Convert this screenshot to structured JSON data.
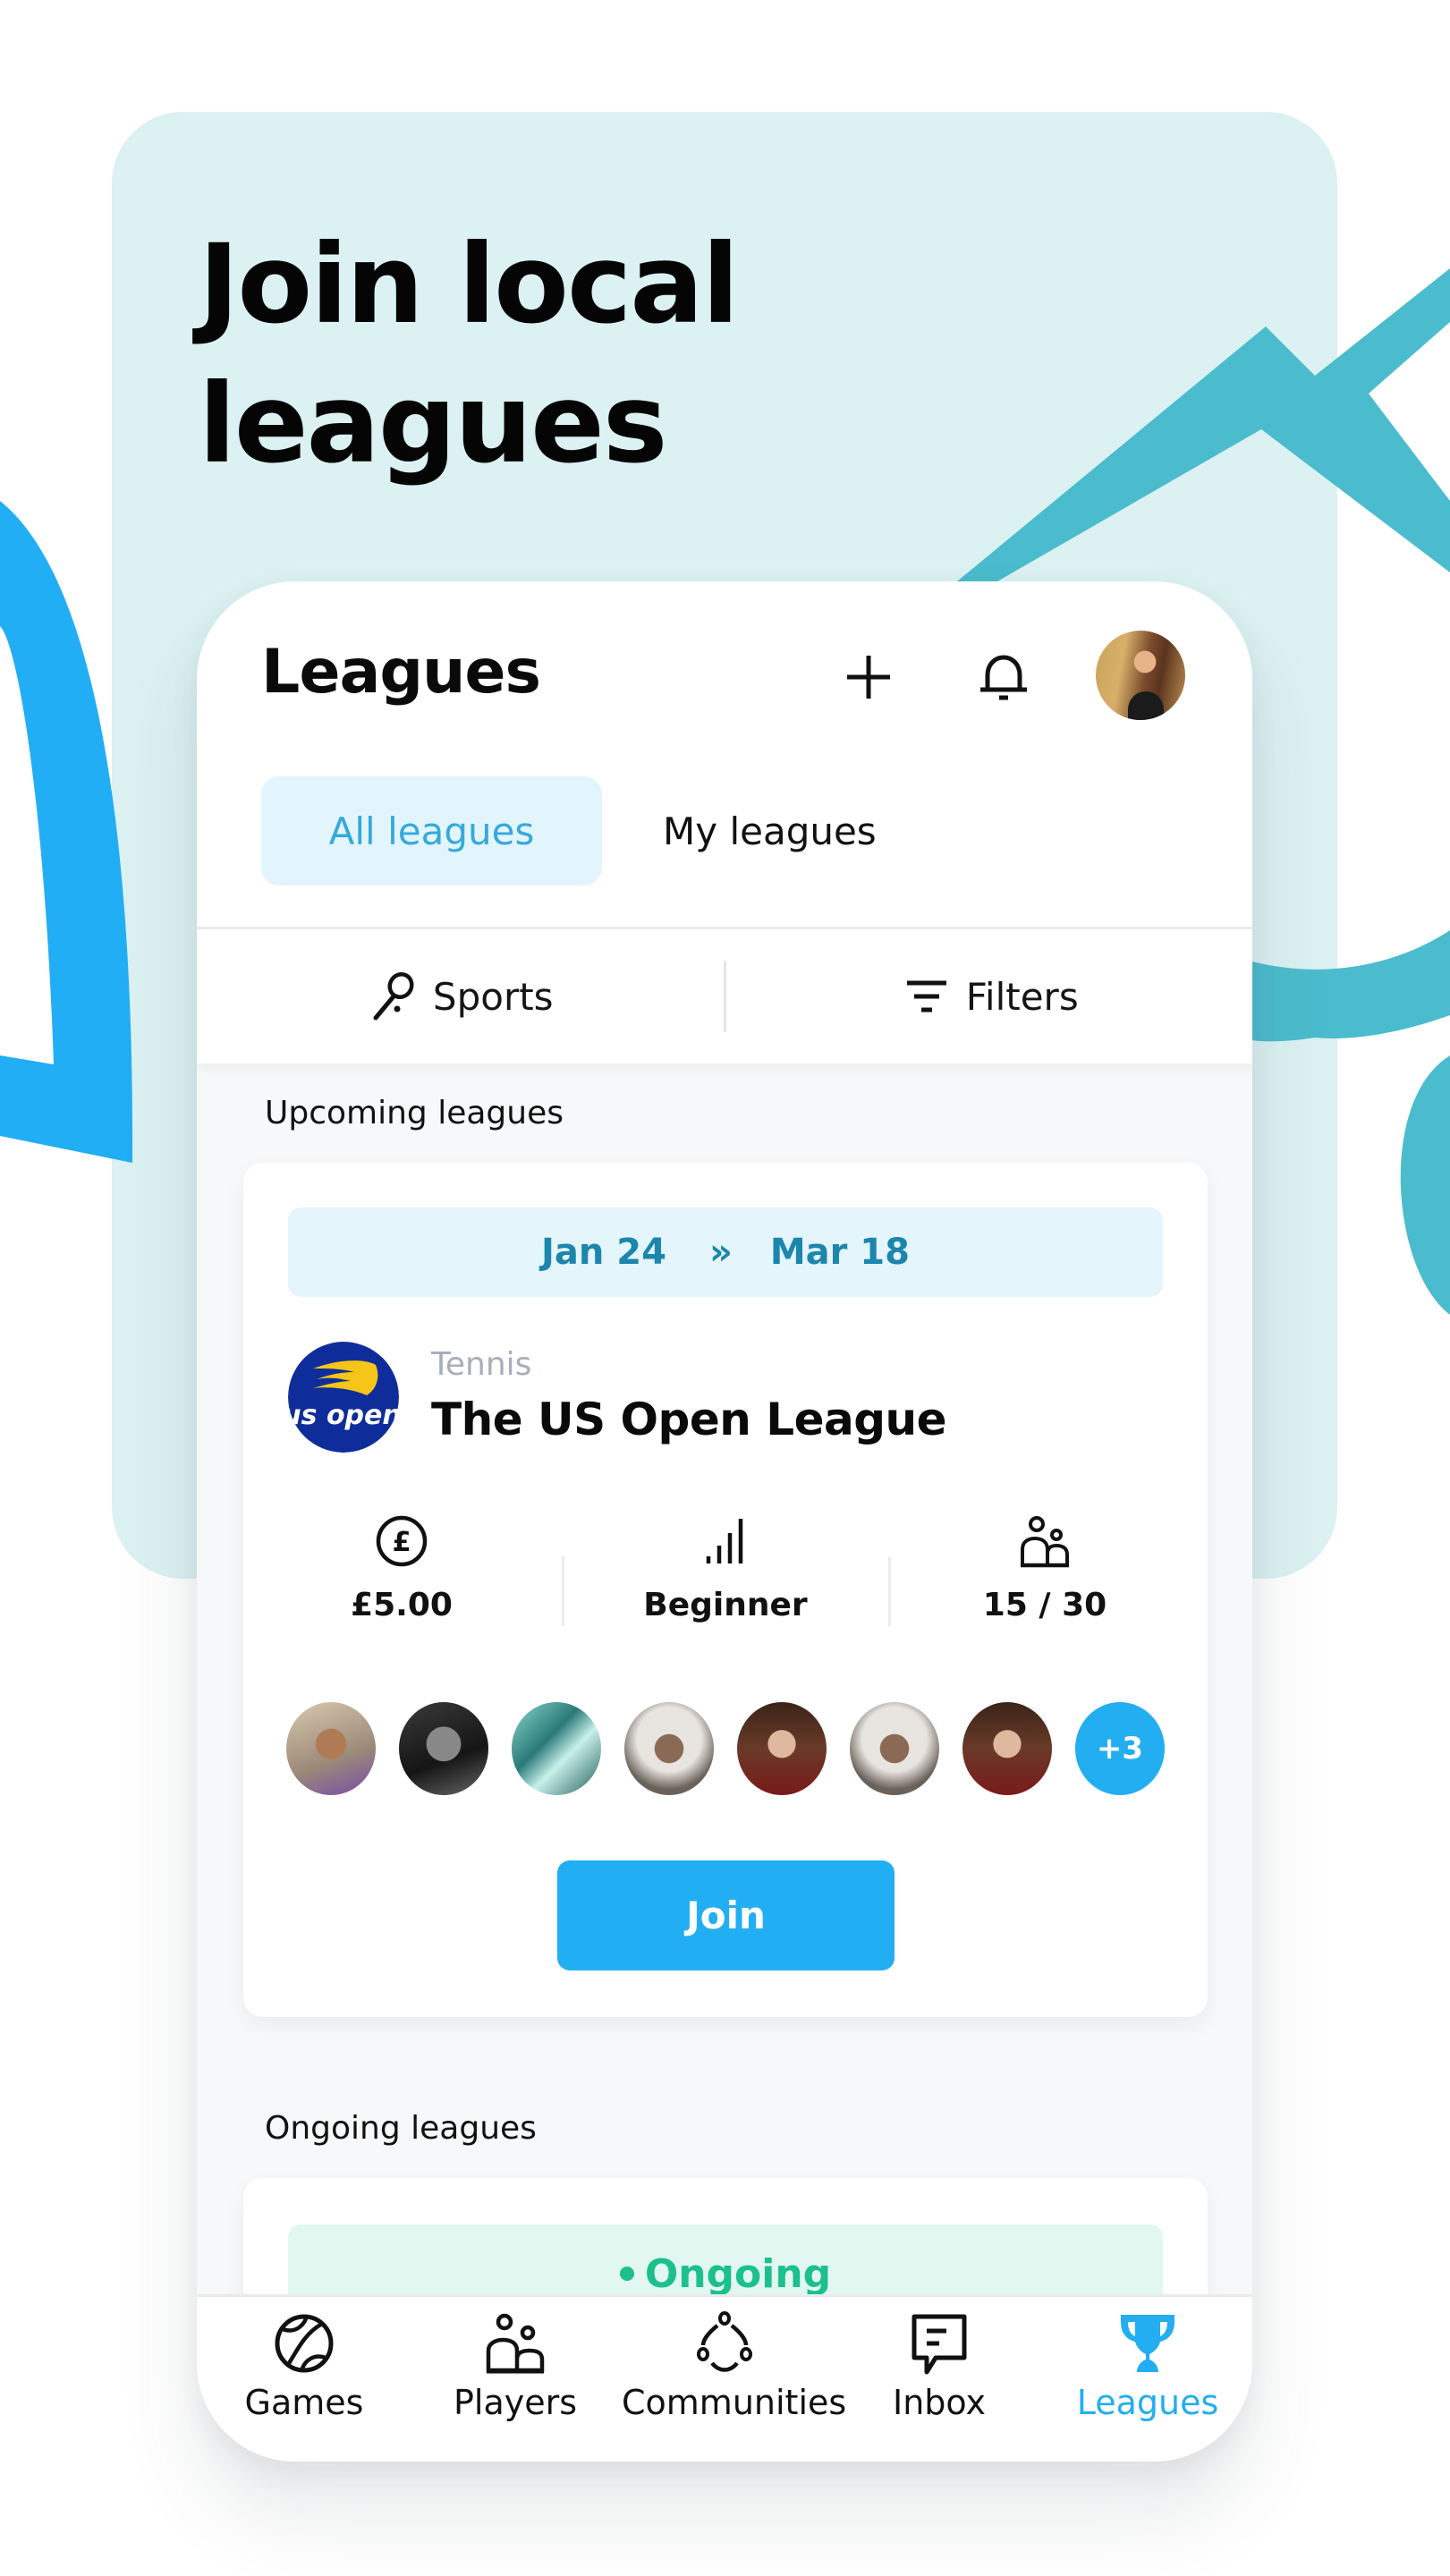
{
  "promo": {
    "headline_line1": "Join local",
    "headline_line2": "leagues"
  },
  "header": {
    "title": "Leagues",
    "add_icon": "plus-icon",
    "notification_icon": "bell-icon",
    "avatar_icon": "profile-avatar"
  },
  "tabs": [
    {
      "label": "All leagues",
      "active": true
    },
    {
      "label": "My leagues",
      "active": false
    }
  ],
  "filters": {
    "sports_label": "Sports",
    "sports_icon": "racket-icon",
    "filters_label": "Filters",
    "filters_icon": "filter-icon"
  },
  "sections": {
    "upcoming_label": "Upcoming leagues",
    "ongoing_label": "Ongoing leagues"
  },
  "upcoming_league": {
    "start_date": "Jan 24",
    "separator": "»",
    "end_date": "Mar 18",
    "logo_text": "us open",
    "sport": "Tennis",
    "name": "The US Open League",
    "stats": [
      {
        "icon": "pound-coin-icon",
        "value": "£5.00"
      },
      {
        "icon": "skill-level-bars-icon",
        "value": "Beginner"
      },
      {
        "icon": "players-icon",
        "value": "15 / 30"
      }
    ],
    "player_avatars_shown": 7,
    "more_players": "+3",
    "join_label": "Join"
  },
  "ongoing_league": {
    "status": "Ongoing"
  },
  "bottom_nav": [
    {
      "label": "Games",
      "icon": "tennis-ball-icon",
      "active": false
    },
    {
      "label": "Players",
      "icon": "players-icon",
      "active": false
    },
    {
      "label": "Communities",
      "icon": "communities-icon",
      "active": false
    },
    {
      "label": "Inbox",
      "icon": "chat-bubble-icon",
      "active": false
    },
    {
      "label": "Leagues",
      "icon": "trophy-icon",
      "active": true
    }
  ],
  "colors": {
    "accent": "#22aef0",
    "panel_bg": "#dbf1f2",
    "deco_teal": "#4bbccd",
    "deco_blue": "#22aef5",
    "date_text": "#1c86ad",
    "ongoing_green": "#1cc08c",
    "usopen_blue": "#0f2d9a",
    "usopen_yellow": "#f5c518"
  }
}
